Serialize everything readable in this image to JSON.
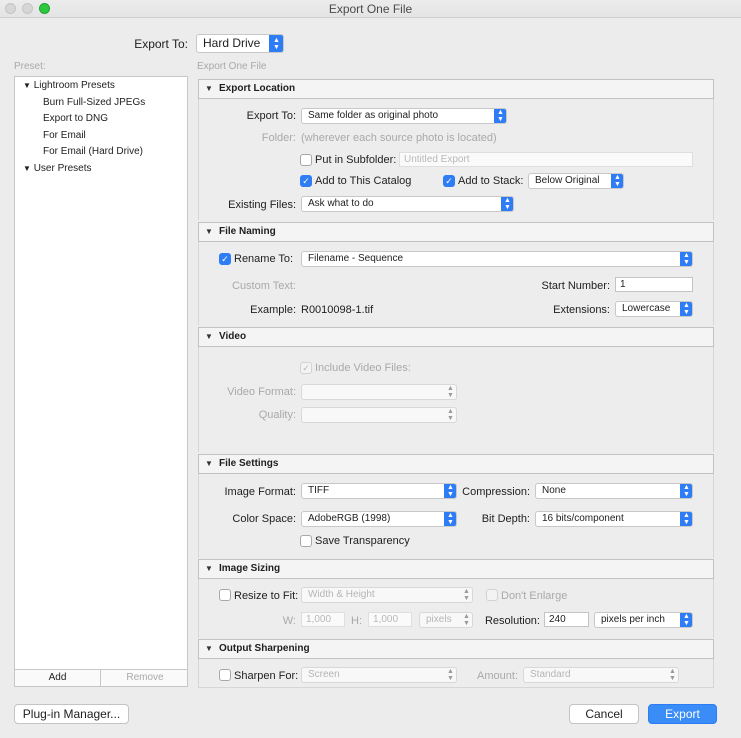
{
  "window": {
    "title": "Export One File"
  },
  "export_to_top": {
    "label": "Export To:",
    "value": "Hard Drive"
  },
  "preset": {
    "label": "Preset:",
    "header_label": "Export One File",
    "groups": [
      {
        "label": "Lightroom Presets",
        "items": [
          "Burn Full-Sized JPEGs",
          "Export to DNG",
          "For Email",
          "For Email (Hard Drive)"
        ]
      },
      {
        "label": "User Presets",
        "items": []
      }
    ],
    "add_label": "Add",
    "remove_label": "Remove"
  },
  "export_location": {
    "title": "Export Location",
    "export_to_label": "Export To:",
    "export_to_value": "Same folder as original photo",
    "folder_label": "Folder:",
    "folder_value": "(wherever each source photo is located)",
    "subfolder_label": "Put in Subfolder:",
    "subfolder_placeholder": "Untitled Export",
    "add_catalog_label": "Add to This Catalog",
    "add_stack_label": "Add to Stack:",
    "stack_value": "Below Original",
    "existing_label": "Existing Files:",
    "existing_value": "Ask what to do"
  },
  "file_naming": {
    "title": "File Naming",
    "rename_label": "Rename To:",
    "rename_value": "Filename - Sequence",
    "custom_text_label": "Custom Text:",
    "start_number_label": "Start Number:",
    "start_number_value": "1",
    "example_label": "Example:",
    "example_value": "R0010098-1.tif",
    "extensions_label": "Extensions:",
    "extensions_value": "Lowercase"
  },
  "video": {
    "title": "Video",
    "include_label": "Include Video Files:",
    "format_label": "Video Format:",
    "quality_label": "Quality:"
  },
  "file_settings": {
    "title": "File Settings",
    "image_format_label": "Image Format:",
    "image_format_value": "TIFF",
    "compression_label": "Compression:",
    "compression_value": "None",
    "color_space_label": "Color Space:",
    "color_space_value": "AdobeRGB (1998)",
    "bit_depth_label": "Bit Depth:",
    "bit_depth_value": "16 bits/component",
    "save_transparency_label": "Save Transparency"
  },
  "image_sizing": {
    "title": "Image Sizing",
    "resize_label": "Resize to Fit:",
    "resize_value": "Width & Height",
    "dont_enlarge_label": "Don't Enlarge",
    "w_label": "W:",
    "w_value": "1,000",
    "h_label": "H:",
    "h_value": "1,000",
    "units_value": "pixels",
    "resolution_label": "Resolution:",
    "resolution_value": "240",
    "resolution_units": "pixels per inch"
  },
  "output_sharpening": {
    "title": "Output Sharpening",
    "sharpen_label": "Sharpen For:",
    "sharpen_value": "Screen",
    "amount_label": "Amount:",
    "amount_value": "Standard"
  },
  "buttons": {
    "plugin_manager": "Plug-in Manager...",
    "cancel": "Cancel",
    "export": "Export"
  }
}
